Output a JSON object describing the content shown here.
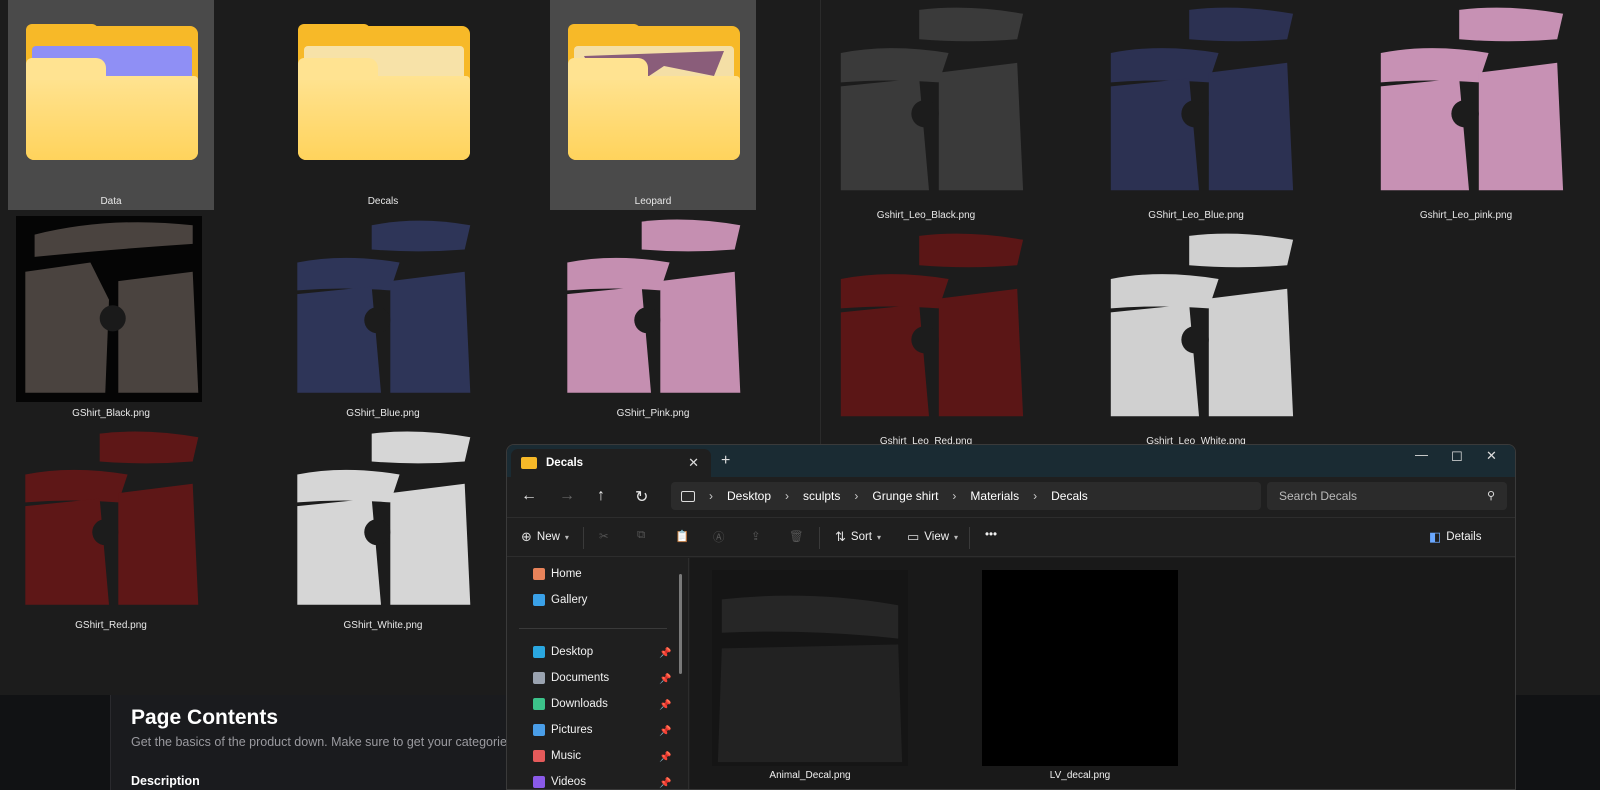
{
  "bg_left": {
    "tiles": [
      {
        "label": "Data",
        "kind": "folder",
        "paper": "#8f8ff5"
      },
      {
        "label": "Decals",
        "kind": "folder",
        "paper": "#f7e2a8"
      },
      {
        "label": "Leopard",
        "kind": "folder",
        "paper": "#f4dfa6"
      },
      {
        "label": "GShirt_Black.png",
        "color": "#4a433f"
      },
      {
        "label": "GShirt_Blue.png",
        "color": "#2e3558"
      },
      {
        "label": "GShirt_Pink.png",
        "color": "#c58fb1"
      },
      {
        "label": "GShirt_Red.png",
        "color": "#5e1717"
      },
      {
        "label": "GShirt_White.png",
        "color": "#d6d6d6"
      }
    ]
  },
  "bg_right": {
    "tiles": [
      {
        "label": "Gshirt_Leo_Black.png",
        "color": "#3a3a3a"
      },
      {
        "label": "GShirt_Leo_Blue.png",
        "color": "#2c3152"
      },
      {
        "label": "Gshirt_Leo_pink.png",
        "color": "#c791b4"
      },
      {
        "label": "Gshirt_Leo_Red.png",
        "color": "#5b1616"
      },
      {
        "label": "Gshirt_Leo_White.png",
        "color": "#d0d0d0"
      }
    ]
  },
  "page": {
    "title": "Page Contents",
    "subtitle": "Get the basics of the product down. Make sure to get your categories a",
    "description": "Description"
  },
  "explorer": {
    "tab_title": "Decals",
    "new_tab": "+",
    "controls": {
      "minimize": "—",
      "maximize": "☐",
      "close": "✕"
    },
    "breadcrumb": [
      "Desktop",
      "sculpts",
      "Grunge shirt",
      "Materials",
      "Decals"
    ],
    "search_placeholder": "Search Decals",
    "toolbar": {
      "new": "New",
      "sort": "Sort",
      "view": "View",
      "more": "•••",
      "details": "Details"
    },
    "sidebar": {
      "top": [
        {
          "label": "Home",
          "icon": "home-icon",
          "color": "#e8835a"
        },
        {
          "label": "Gallery",
          "icon": "gallery-icon",
          "color": "#3aa1e8"
        }
      ],
      "pinned": [
        {
          "label": "Desktop",
          "icon": "desktop-icon",
          "color": "#2aa7e0"
        },
        {
          "label": "Documents",
          "icon": "documents-icon",
          "color": "#9aa3b0"
        },
        {
          "label": "Downloads",
          "icon": "downloads-icon",
          "color": "#3cc28a"
        },
        {
          "label": "Pictures",
          "icon": "pictures-icon",
          "color": "#4a9ee8"
        },
        {
          "label": "Music",
          "icon": "music-icon",
          "color": "#e45a5a"
        },
        {
          "label": "Videos",
          "icon": "videos-icon",
          "color": "#8a5ae8"
        }
      ]
    },
    "files": [
      {
        "label": "Animal_Decal.png",
        "color": "#2a2a2a"
      },
      {
        "label": "LV_decal.png",
        "color": "#000000"
      }
    ]
  }
}
